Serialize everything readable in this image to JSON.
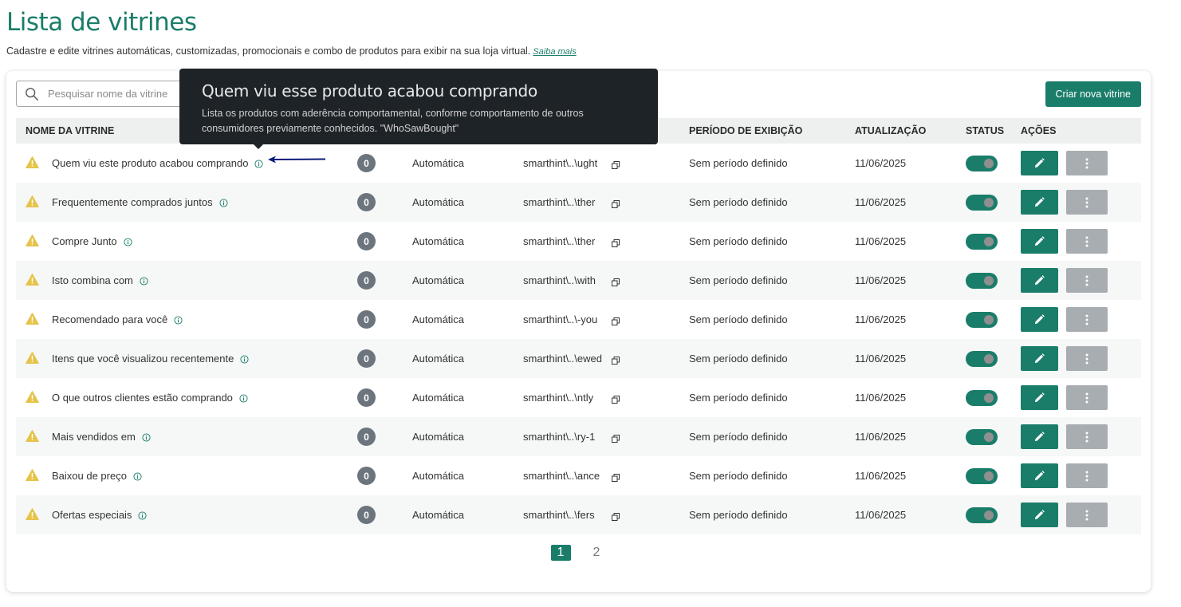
{
  "page": {
    "title": "Lista de vitrines",
    "subtitle": "Cadastre e edite vitrines automáticas, customizadas, promocionais e combo de produtos para exibir na sua loja virtual.",
    "learn_more": "Saiba mais"
  },
  "toolbar": {
    "search_placeholder": "Pesquisar nome da vitrine",
    "create_label": "Criar nova vitrine"
  },
  "table": {
    "headers": {
      "name": "NOME DA VITRINE",
      "period": "PERÍODO DE EXIBIÇÃO",
      "updated": "ATUALIZAÇÃO",
      "status": "STATUS",
      "actions": "AÇÕES"
    },
    "rows": [
      {
        "name": "Quem viu este produto acabou comprando",
        "count": "0",
        "type": "Automática",
        "id": "smarthint\\..\\ught",
        "period": "Sem período definido",
        "updated": "11/06/2025"
      },
      {
        "name": "Frequentemente comprados juntos",
        "count": "0",
        "type": "Automática",
        "id": "smarthint\\..\\ther",
        "period": "Sem período definido",
        "updated": "11/06/2025"
      },
      {
        "name": "Compre Junto",
        "count": "0",
        "type": "Automática",
        "id": "smarthint\\..\\ther",
        "period": "Sem período definido",
        "updated": "11/06/2025"
      },
      {
        "name": "Isto combina com",
        "count": "0",
        "type": "Automática",
        "id": "smarthint\\..\\with",
        "period": "Sem período definido",
        "updated": "11/06/2025"
      },
      {
        "name": "Recomendado para você",
        "count": "0",
        "type": "Automática",
        "id": "smarthint\\..\\-you",
        "period": "Sem período definido",
        "updated": "11/06/2025"
      },
      {
        "name": "Itens que você visualizou recentemente",
        "count": "0",
        "type": "Automática",
        "id": "smarthint\\..\\ewed",
        "period": "Sem período definido",
        "updated": "11/06/2025"
      },
      {
        "name": "O que outros clientes estão comprando",
        "count": "0",
        "type": "Automática",
        "id": "smarthint\\..\\ntly",
        "period": "Sem período definido",
        "updated": "11/06/2025"
      },
      {
        "name": "Mais vendidos em",
        "count": "0",
        "type": "Automática",
        "id": "smarthint\\..\\ry-1",
        "period": "Sem período definido",
        "updated": "11/06/2025"
      },
      {
        "name": "Baixou de preço",
        "count": "0",
        "type": "Automática",
        "id": "smarthint\\..\\ance",
        "period": "Sem período definido",
        "updated": "11/06/2025"
      },
      {
        "name": "Ofertas especiais",
        "count": "0",
        "type": "Automática",
        "id": "smarthint\\..\\fers",
        "period": "Sem período definido",
        "updated": "11/06/2025"
      }
    ]
  },
  "pagination": {
    "pages": [
      "1",
      "2"
    ],
    "current": "1"
  },
  "tooltip": {
    "title": "Quem viu esse produto acabou comprando",
    "description": "Lista os produtos com aderência comportamental, conforme comportamento de outros consumidores previamente conhecidos. \"WhoSawBought\""
  },
  "icons": {
    "warning": "warning-triangle-icon",
    "info": "info-circle-icon",
    "copy": "copy-icon",
    "edit": "pencil-icon",
    "more": "more-vertical-icon",
    "search": "search-icon"
  },
  "colors": {
    "brand": "#1a7d6a",
    "warning": "#e6c44a",
    "badge": "#6c757d",
    "tooltip_bg": "#1e2328",
    "annotation_arrow": "#0a1a7a"
  }
}
